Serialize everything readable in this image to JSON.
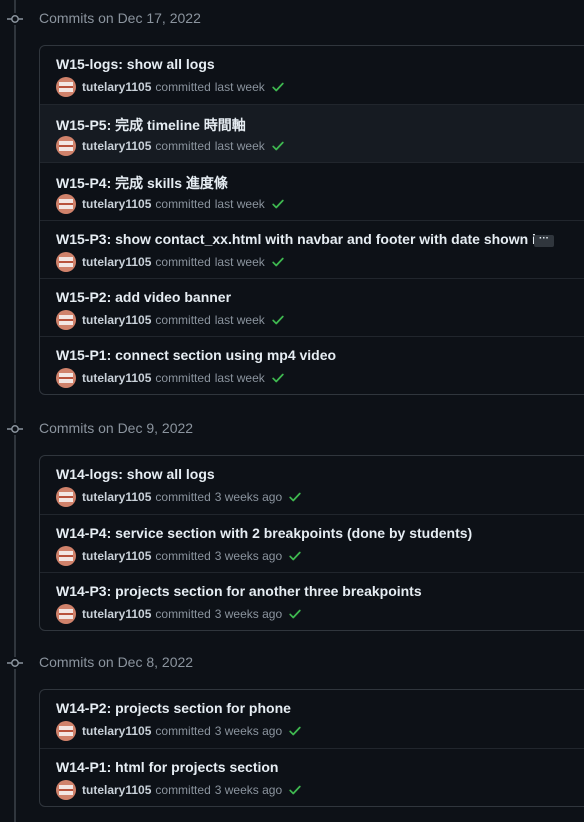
{
  "groups": [
    {
      "title": "Commits on Dec 17, 2022",
      "commits": [
        {
          "message": "W15-logs: show all logs",
          "author": "tutelary1105",
          "action": "committed",
          "time": "last week"
        },
        {
          "message": "W15-P5: 完成 timeline 時間軸",
          "author": "tutelary1105",
          "action": "committed",
          "time": "last week"
        },
        {
          "message": "W15-P4: 完成 skills 進度條",
          "author": "tutelary1105",
          "action": "committed",
          "time": "last week"
        },
        {
          "message": "W15-P3: show contact_xx.html with navbar and footer with date shown i...",
          "author": "tutelary1105",
          "action": "committed",
          "time": "last week",
          "ellipsis": "···"
        },
        {
          "message": "W15-P2: add video banner",
          "author": "tutelary1105",
          "action": "committed",
          "time": "last week"
        },
        {
          "message": "W15-P1: connect section using mp4 video",
          "author": "tutelary1105",
          "action": "committed",
          "time": "last week"
        }
      ]
    },
    {
      "title": "Commits on Dec 9, 2022",
      "commits": [
        {
          "message": "W14-logs: show all logs",
          "author": "tutelary1105",
          "action": "committed",
          "time": "3 weeks ago"
        },
        {
          "message": "W14-P4: service section with 2 breakpoints (done by students)",
          "author": "tutelary1105",
          "action": "committed",
          "time": "3 weeks ago"
        },
        {
          "message": "W14-P3: projects section for another three breakpoints",
          "author": "tutelary1105",
          "action": "committed",
          "time": "3 weeks ago"
        }
      ]
    },
    {
      "title": "Commits on Dec 8, 2022",
      "commits": [
        {
          "message": "W14-P2: projects section for phone",
          "author": "tutelary1105",
          "action": "committed",
          "time": "3 weeks ago"
        },
        {
          "message": "W14-P1: html for projects section",
          "author": "tutelary1105",
          "action": "committed",
          "time": "3 weeks ago"
        }
      ]
    }
  ],
  "colors": {
    "background": "#0d1117",
    "border": "#30363d",
    "success": "#3fb950",
    "muted": "#8b949e"
  },
  "icons": {
    "commit_node": "git-commit-icon",
    "status": "check-icon",
    "avatar": "identicon-avatar"
  }
}
